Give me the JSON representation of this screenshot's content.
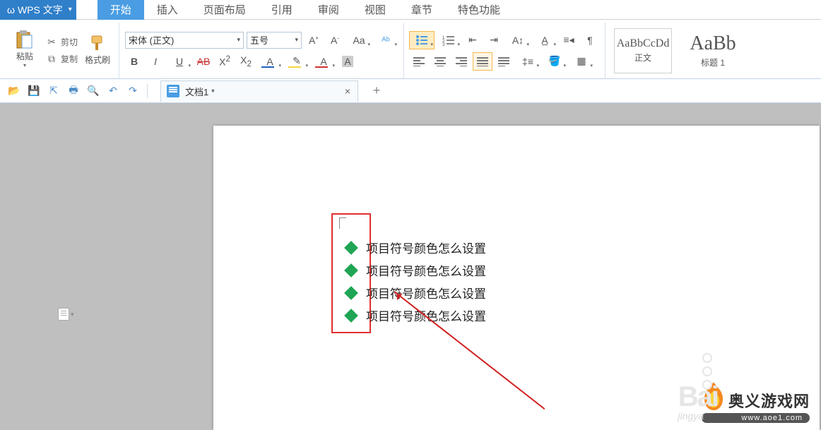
{
  "app": {
    "name": "WPS 文字"
  },
  "menu_tabs": [
    "开始",
    "插入",
    "页面布局",
    "引用",
    "审阅",
    "视图",
    "章节",
    "特色功能"
  ],
  "active_menu_tab_index": 0,
  "clipboard": {
    "paste_label": "粘贴",
    "cut_label": "剪切",
    "copy_label": "复制",
    "format_painter_label": "格式刷"
  },
  "font": {
    "family": "宋体 (正文)",
    "size": "五号"
  },
  "styles": [
    {
      "sample": "AaBbCcDd",
      "label": "正文",
      "sample_size": "16px"
    },
    {
      "sample": "AaBb",
      "label": "标题 1",
      "sample_size": "28px"
    }
  ],
  "doc_tab": {
    "title": "文档1 *"
  },
  "document": {
    "lines": [
      "项目符号颜色怎么设置",
      "项目符号颜色怎么设置",
      "项目符号颜色怎么设置",
      "项目符号颜色怎么设置"
    ]
  },
  "watermark": {
    "bai": "Bai",
    "jy": "jingya",
    "cn": "奥义游戏网",
    "url": "www.aoe1.com"
  }
}
